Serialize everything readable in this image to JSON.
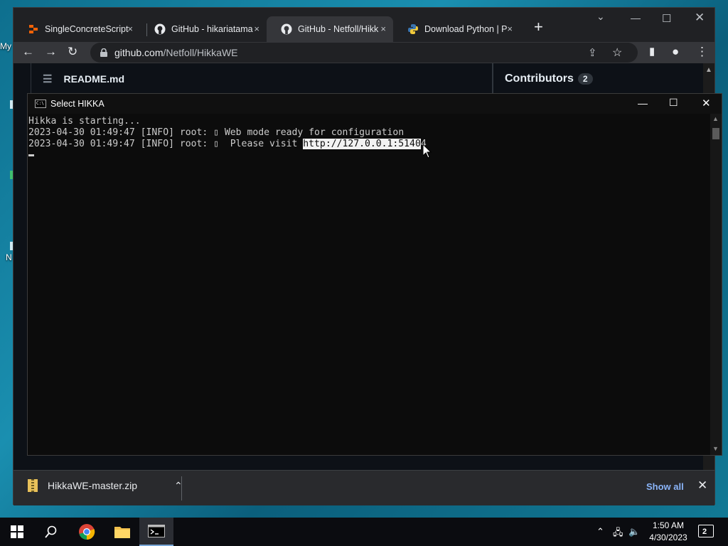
{
  "desktop": {
    "labels": [
      "My",
      "N"
    ]
  },
  "browser": {
    "tabs": [
      {
        "title": "SingleConcreteScript",
        "close": "×"
      },
      {
        "title": "GitHub - hikariatama",
        "close": "×"
      },
      {
        "title": "GitHub - Netfoll/Hikk",
        "close": "×"
      },
      {
        "title": "Download Python | P",
        "close": "×"
      }
    ],
    "new_tab": "+",
    "url": {
      "host": "github.com",
      "path": "/Netfoll/HikkaWE"
    },
    "page": {
      "readme": "README.md",
      "contributors_label": "Contributors",
      "contributors_count": "2"
    },
    "downloads": {
      "file": "HikkaWE-master.zip",
      "show_all": "Show all"
    }
  },
  "console": {
    "title": "Select HIKKA",
    "lines": [
      "Hikka is starting...",
      "2023-04-30 01:49:47 [INFO] root: ▯ Web mode ready for configuration"
    ],
    "line3_prefix": "2023-04-30 01:49:47 [INFO] root: ▯  Please visit ",
    "line3_selected": "http://127.0.0.1:5140",
    "line3_rest": "4"
  },
  "taskbar": {
    "time": "1:50 AM",
    "date": "4/30/2023",
    "notifications": "2"
  },
  "colors": {
    "accent": "#8ab4f8",
    "console_bg": "#0c0c0c",
    "github_bg": "#0d1117"
  }
}
